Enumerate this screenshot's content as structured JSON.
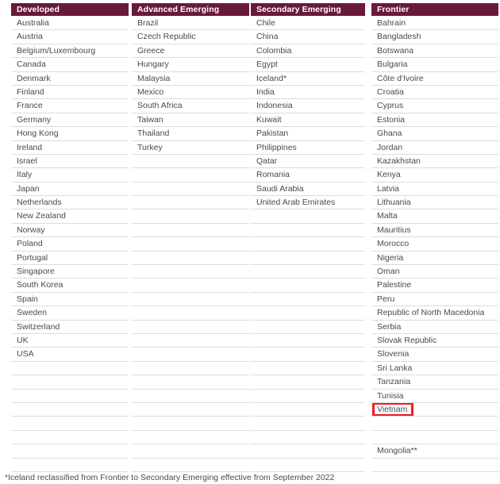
{
  "table": {
    "columns": [
      {
        "header": "Developed",
        "items": [
          "Australia",
          "Austria",
          "Belgium/Luxembourg",
          "Canada",
          "Denmark",
          "Finland",
          "France",
          "Germany",
          "Hong Kong",
          "Ireland",
          "Israel",
          "Italy",
          "Japan",
          "Netherlands",
          "New Zealand",
          "Norway",
          "Poland",
          "Portugal",
          "Singapore",
          "South Korea",
          "Spain",
          "Sweden",
          "Switzerland",
          "UK",
          "USA"
        ]
      },
      {
        "header": "Advanced Emerging",
        "items": [
          "Brazil",
          "Czech Republic",
          "Greece",
          "Hungary",
          "Malaysia",
          "Mexico",
          "South Africa",
          "Taiwan",
          "Thailand",
          "Turkey"
        ]
      },
      {
        "header": "Secondary Emerging",
        "items": [
          "Chile",
          "China",
          "Colombia",
          "Egypt",
          "Iceland*",
          "India",
          "Indonesia",
          "Kuwait",
          "Pakistan",
          "Philippines",
          "Qatar",
          "Romania",
          "Saudi Arabia",
          "United Arab Emirates"
        ]
      },
      {
        "header": "Frontier",
        "items": [
          "Bahrain",
          "Bangladesh",
          "Botswana",
          "Bulgaria",
          "Côte d'Ivoire",
          "Croatia",
          "Cyprus",
          "Estonia",
          "Ghana",
          "Jordan",
          "Kazakhstan",
          "Kenya",
          "Latvia",
          "Lithuania",
          "Malta",
          "Mauritius",
          "Morocco",
          "Nigeria",
          "Oman",
          "Palestine",
          "Peru",
          "Republic of North Macedonia",
          "Serbia",
          "Slovak Republic",
          "Slovenia",
          "Sri Lanka",
          "Tanzania",
          "Tunisia",
          "Vietnam",
          "",
          "",
          "Mongolia**"
        ]
      }
    ],
    "total_rows": 33,
    "highlight": {
      "column_index": 3,
      "row_index": 28,
      "value": "Vietnam",
      "color": "#ee1c25"
    }
  },
  "footnote": {
    "text": "*Iceland reclassified from Frontier to Secondary Emerging effective from September 2022"
  },
  "colors": {
    "header_background": "#69193C",
    "header_text": "#ffffff",
    "row_text": "#4a4a4a",
    "row_divider": "#dcdcdc",
    "highlight_border": "#ee1c25",
    "page_background": "#ffffff"
  }
}
